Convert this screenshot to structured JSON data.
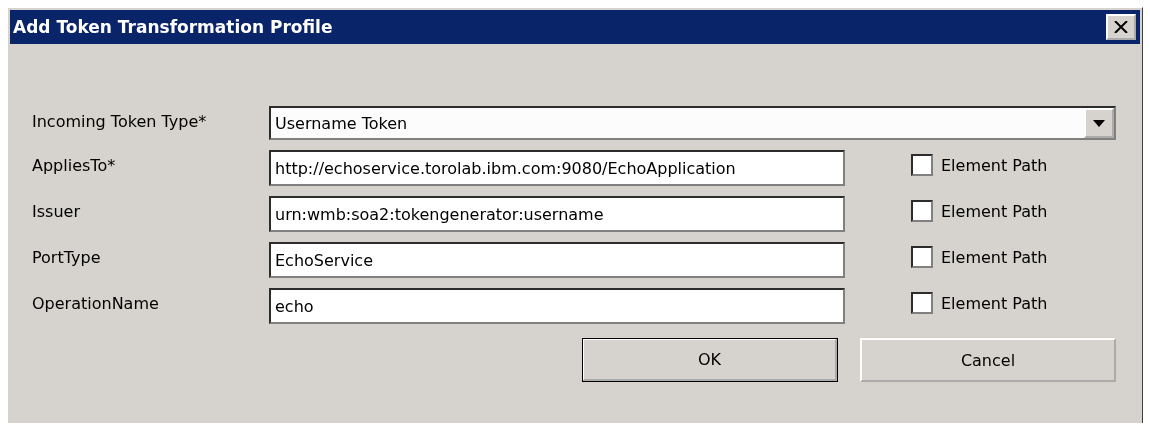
{
  "window": {
    "title": "Add Token Transformation Profile"
  },
  "token_type": {
    "label": "Incoming Token Type*",
    "value": "Username Token"
  },
  "fields": [
    {
      "label": "AppliesTo*",
      "value": "http://echoservice.torolab.ibm.com:9080/EchoApplication",
      "checkbox": {
        "label": "Element Path",
        "checked": false
      }
    },
    {
      "label": "Issuer",
      "value": "urn:wmb:soa2:tokengenerator:username",
      "checkbox": {
        "label": "Element Path",
        "checked": false
      }
    },
    {
      "label": "PortType",
      "value": "EchoService",
      "checkbox": {
        "label": "Element Path",
        "checked": false
      }
    },
    {
      "label": "OperationName",
      "value": "echo",
      "checkbox": {
        "label": "Element Path",
        "checked": false
      }
    }
  ],
  "buttons": [
    {
      "label": "OK",
      "default": true
    },
    {
      "label": "Cancel",
      "default": false
    }
  ]
}
